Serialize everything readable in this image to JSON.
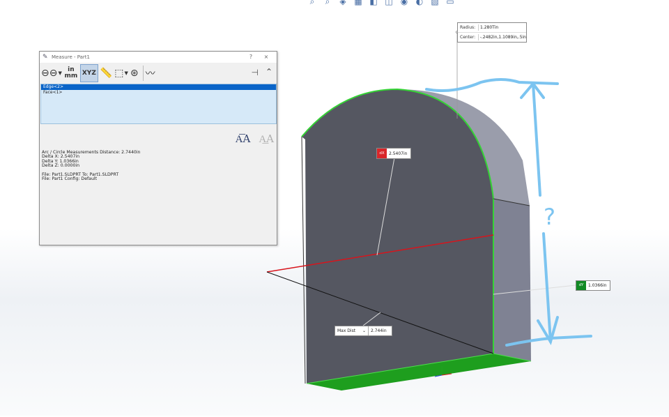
{
  "dialog": {
    "title": "Measure - Part1",
    "help": "?",
    "close": "×",
    "units_top": "in",
    "units_bottom": "mm",
    "xyz_label": "XYZ",
    "selections": [
      "Edge<2>",
      "Face<1>"
    ],
    "results": [
      "Arc / Circle Measurements Distance: 2.7440in",
      "Delta X: 2.5407in",
      "Delta Y: 1.0366in",
      "Delta Z: 0.0000in",
      "",
      "File: Part1.SLDPRT To: Part1.SLDPRT",
      "File: Part1 Config: Default"
    ]
  },
  "tags": {
    "radius_key": "Radius:",
    "radius_val": "1.280Tin",
    "center_key": "Center:",
    "center_val": "-.2482in,1.1089in,.5in",
    "dx_badge": "dX",
    "dx_val": "2.5407in",
    "dy_badge": "dY",
    "dy_val": "1.0366in",
    "maxdist_option": "Max Dist",
    "maxdist_val": "2.744in"
  },
  "annotation": {
    "question_mark": "?",
    "color": "#7cc4f0"
  },
  "colors": {
    "face": "#555761",
    "side_face": "#8a8d9c",
    "edge_highlight": "#35d235",
    "bottom_face": "#20a020",
    "red_line": "#d8141c"
  }
}
